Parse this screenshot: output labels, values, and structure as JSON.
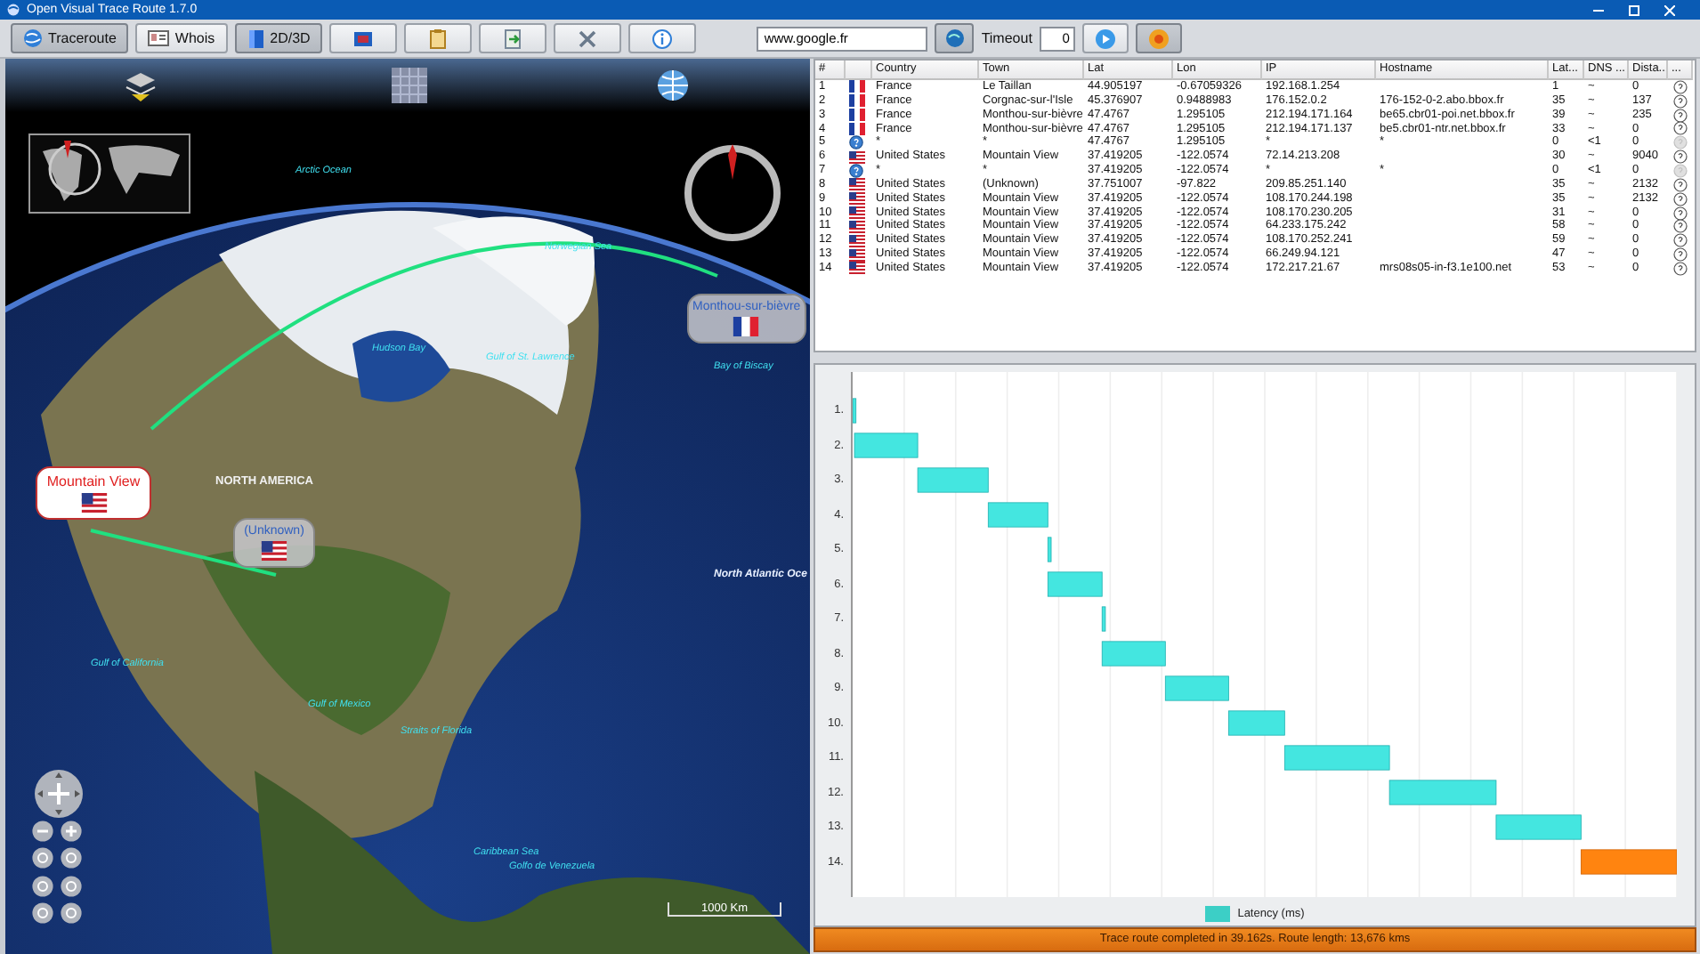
{
  "window": {
    "title": "Open Visual Trace Route 1.7.0"
  },
  "toolbar": {
    "buttons": [
      {
        "label": "Traceroute",
        "pressed": true
      },
      {
        "label": "Whois",
        "pressed": false
      },
      {
        "label": "2D/3D",
        "pressed": true
      }
    ],
    "address": {
      "value": "www.google.fr"
    },
    "timeout": {
      "label": "Timeout",
      "value": "0"
    }
  },
  "map": {
    "labels": [
      {
        "text": "Arctic Ocean",
        "kind": "water"
      },
      {
        "text": "Norwegian Sea",
        "kind": "water"
      },
      {
        "text": "Hudson Bay",
        "kind": "water"
      },
      {
        "text": "Gulf of St. Lawrence",
        "kind": "water"
      },
      {
        "text": "Bay of Biscay",
        "kind": "water"
      },
      {
        "text": "NORTH AMERICA",
        "kind": "region"
      },
      {
        "text": "North Atlantic Oce",
        "kind": "ocean"
      },
      {
        "text": "Gulf of California",
        "kind": "water"
      },
      {
        "text": "Gulf of Mexico",
        "kind": "water"
      },
      {
        "text": "Straits of Florida",
        "kind": "water"
      },
      {
        "text": "Caribbean Sea",
        "kind": "water"
      },
      {
        "text": "Golfo de Venezuela",
        "kind": "water"
      }
    ],
    "markers": [
      {
        "label": "Mountain View",
        "kind": "united-states",
        "selected": true
      },
      {
        "label": "(Unknown)",
        "kind": "united-states",
        "selected": false
      },
      {
        "label": "Monthou-sur-bièvre",
        "kind": "france",
        "selected": false
      }
    ],
    "scale": "1000 Km"
  },
  "table": {
    "columns": [
      "#",
      "Country",
      "Town",
      "Lat",
      "Lon",
      "IP",
      "Hostname",
      "Lat...",
      "DNS ...",
      "Dista...",
      "..."
    ],
    "rows": [
      {
        "num": "1",
        "kind": "france",
        "country": "France",
        "town": "Le Taillan",
        "lat": "44.905197",
        "lon": "-0.67059326",
        "ip": "192.168.1.254",
        "hostname": "",
        "latency": "1",
        "dns": "~",
        "distance": "0",
        "disabled": false
      },
      {
        "num": "2",
        "kind": "france",
        "country": "France",
        "town": "Corgnac-sur-l'Isle",
        "lat": "45.376907",
        "lon": "0.9488983",
        "ip": "176.152.0.2",
        "hostname": "176-152-0-2.abo.bbox.fr",
        "latency": "35",
        "dns": "~",
        "distance": "137",
        "disabled": false
      },
      {
        "num": "3",
        "kind": "france",
        "country": "France",
        "town": "Monthou-sur-bièvre",
        "lat": "47.4767",
        "lon": "1.295105",
        "ip": "212.194.171.164",
        "hostname": "be65.cbr01-poi.net.bbox.fr",
        "latency": "39",
        "dns": "~",
        "distance": "235",
        "disabled": false
      },
      {
        "num": "4",
        "kind": "france",
        "country": "France",
        "town": "Monthou-sur-bièvre",
        "lat": "47.4767",
        "lon": "1.295105",
        "ip": "212.194.171.137",
        "hostname": "be5.cbr01-ntr.net.bbox.fr",
        "latency": "33",
        "dns": "~",
        "distance": "0",
        "disabled": false
      },
      {
        "num": "5",
        "kind": "unknown",
        "country": "*",
        "town": "*",
        "lat": "47.4767",
        "lon": "1.295105",
        "ip": "*",
        "hostname": "*",
        "latency": "0",
        "dns": "<1",
        "distance": "0",
        "disabled": true
      },
      {
        "num": "6",
        "kind": "united-states",
        "country": "United States",
        "town": "Mountain View",
        "lat": "37.419205",
        "lon": "-122.0574",
        "ip": "72.14.213.208",
        "hostname": "",
        "latency": "30",
        "dns": "~",
        "distance": "9040",
        "disabled": false
      },
      {
        "num": "7",
        "kind": "unknown",
        "country": "*",
        "town": "*",
        "lat": "37.419205",
        "lon": "-122.0574",
        "ip": "*",
        "hostname": "*",
        "latency": "0",
        "dns": "<1",
        "distance": "0",
        "disabled": true
      },
      {
        "num": "8",
        "kind": "united-states",
        "country": "United States",
        "town": "(Unknown)",
        "lat": "37.751007",
        "lon": "-97.822",
        "ip": "209.85.251.140",
        "hostname": "",
        "latency": "35",
        "dns": "~",
        "distance": "2132",
        "disabled": false
      },
      {
        "num": "9",
        "kind": "united-states",
        "country": "United States",
        "town": "Mountain View",
        "lat": "37.419205",
        "lon": "-122.0574",
        "ip": "108.170.244.198",
        "hostname": "",
        "latency": "35",
        "dns": "~",
        "distance": "2132",
        "disabled": false
      },
      {
        "num": "10",
        "kind": "united-states",
        "country": "United States",
        "town": "Mountain View",
        "lat": "37.419205",
        "lon": "-122.0574",
        "ip": "108.170.230.205",
        "hostname": "",
        "latency": "31",
        "dns": "~",
        "distance": "0",
        "disabled": false
      },
      {
        "num": "11",
        "kind": "united-states",
        "country": "United States",
        "town": "Mountain View",
        "lat": "37.419205",
        "lon": "-122.0574",
        "ip": "64.233.175.242",
        "hostname": "",
        "latency": "58",
        "dns": "~",
        "distance": "0",
        "disabled": false
      },
      {
        "num": "12",
        "kind": "united-states",
        "country": "United States",
        "town": "Mountain View",
        "lat": "37.419205",
        "lon": "-122.0574",
        "ip": "108.170.252.241",
        "hostname": "",
        "latency": "59",
        "dns": "~",
        "distance": "0",
        "disabled": false
      },
      {
        "num": "13",
        "kind": "united-states",
        "country": "United States",
        "town": "Mountain View",
        "lat": "37.419205",
        "lon": "-122.0574",
        "ip": "66.249.94.121",
        "hostname": "",
        "latency": "47",
        "dns": "~",
        "distance": "0",
        "disabled": false
      },
      {
        "num": "14",
        "kind": "united-states",
        "country": "United States",
        "town": "Mountain View",
        "lat": "37.419205",
        "lon": "-122.0574",
        "ip": "172.217.21.67",
        "hostname": "mrs08s05-in-f3.1e100.net",
        "latency": "53",
        "dns": "~",
        "distance": "0",
        "disabled": false
      }
    ]
  },
  "chart": {
    "rows": [
      {
        "label": "1.",
        "highlighted": false
      },
      {
        "label": "2.",
        "highlighted": false
      },
      {
        "label": "3.",
        "highlighted": false
      },
      {
        "label": "4.",
        "highlighted": false
      },
      {
        "label": "5.",
        "highlighted": false
      },
      {
        "label": "6.",
        "highlighted": false
      },
      {
        "label": "7.",
        "highlighted": false
      },
      {
        "label": "8.",
        "highlighted": false
      },
      {
        "label": "9.",
        "highlighted": false
      },
      {
        "label": "10.",
        "highlighted": false
      },
      {
        "label": "11.",
        "highlighted": false
      },
      {
        "label": "12.",
        "highlighted": false
      },
      {
        "label": "13.",
        "highlighted": false
      },
      {
        "label": "14.",
        "highlighted": true
      }
    ],
    "legend": "Latency (ms)"
  },
  "status_bar": "Trace route completed in 39.162s. Route length: 13,676 kms"
}
